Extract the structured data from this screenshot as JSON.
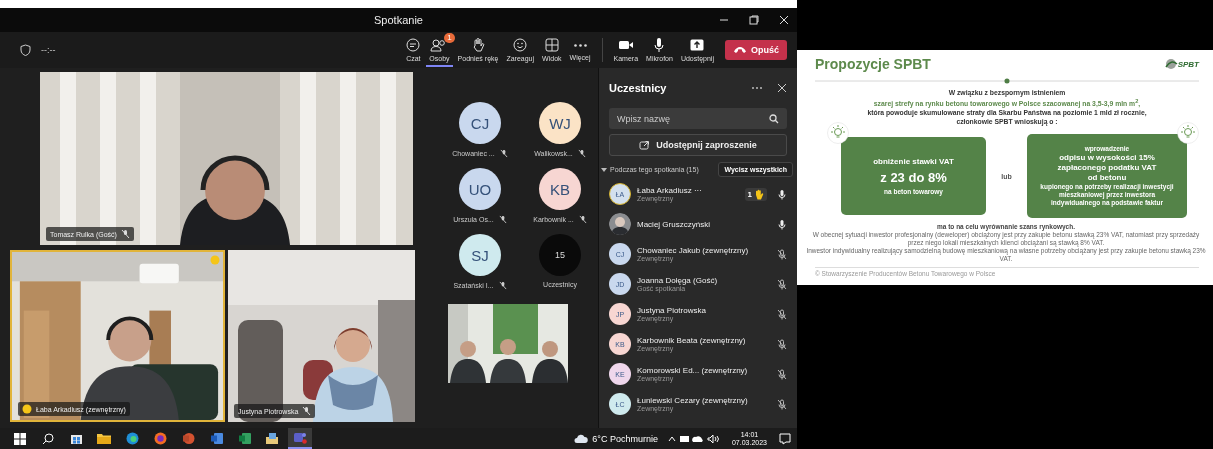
{
  "window": {
    "title": "Spotkanie"
  },
  "toolbar": {
    "timer": "--:--",
    "items": [
      {
        "kind": "chat",
        "label": "Czat",
        "selected": false
      },
      {
        "kind": "people",
        "label": "Osoby",
        "badge": "1",
        "selected": true
      },
      {
        "kind": "hand",
        "label": "Podnieś rękę",
        "selected": false
      },
      {
        "kind": "react",
        "label": "Zareaguj",
        "selected": false
      },
      {
        "kind": "view",
        "label": "Widok",
        "selected": false
      },
      {
        "kind": "more",
        "label": "Więcej",
        "selected": false
      }
    ],
    "devices": [
      {
        "kind": "camera",
        "label": "Kamera"
      },
      {
        "kind": "mic",
        "label": "Mikrofon"
      },
      {
        "kind": "share",
        "label": "Udostępnij"
      }
    ],
    "leave": "Opuść"
  },
  "videos": [
    {
      "kind": "picture",
      "name": "Tomasz Rulka (Gość)",
      "muted": true
    },
    {
      "kind": "picture",
      "name": "Łaba Arkadiusz (zewnętrzny)",
      "hand_raised": true,
      "highlighted": true
    },
    {
      "kind": "picture",
      "name": "Justyna Piotrowska",
      "muted": true
    },
    {
      "kind": "picture"
    }
  ],
  "avatar_grid": [
    {
      "kind": "person",
      "initials": "CJ",
      "name": "Chowaniec ...",
      "color": "#c9d8ee",
      "muted": true
    },
    {
      "kind": "person",
      "initials": "WJ",
      "name": "Walikowsk...",
      "color": "#fbe3c6",
      "muted": true
    },
    {
      "kind": "person",
      "initials": "UO",
      "name": "Urszula Os...",
      "color": "#c9d8ee",
      "muted": true
    },
    {
      "kind": "person",
      "initials": "KB",
      "name": "Karbownik ...",
      "color": "#f7d6d2",
      "muted": true
    },
    {
      "kind": "person",
      "initials": "SJ",
      "name": "Szatański I...",
      "color": "#cfeaee",
      "muted": true
    },
    {
      "kind": "overflow",
      "initials": "15",
      "name": "Uczestnicy"
    }
  ],
  "panel": {
    "title": "Uczestnicy",
    "search_placeholder": "Wpisz nazwę",
    "share_button": "Udostępnij zaproszenie",
    "section": {
      "label": "Podczas tego spotkania (15)",
      "expanded": true,
      "mute_all": "Wycisz wszystkich"
    },
    "participants": [
      {
        "kind": "initials",
        "initials": "ŁA",
        "name": "Łaba Arkadiusz ···",
        "role": "Zewnętrzny",
        "color": "#d3e0ee",
        "highlighted": true,
        "hand_count": "1",
        "muted": false
      },
      {
        "name": "Maciej Gruszczyński",
        "highlighted": false,
        "muted": false
      },
      {
        "kind": "initials",
        "initials": "CJ",
        "name": "Chowaniec Jakub (zewnętrzny)",
        "role": "Zewnętrzny",
        "color": "#c9d8ee",
        "highlighted": false,
        "muted": true
      },
      {
        "kind": "initials",
        "initials": "JD",
        "name": "Joanna Dołęga (Gość)",
        "role": "Gość spotkania",
        "color": "#c9d8ee",
        "highlighted": false,
        "muted": true
      },
      {
        "kind": "initials",
        "initials": "JP",
        "name": "Justyna Piotrowska",
        "role": "Zewnętrzny",
        "color": "#f7d6d2",
        "highlighted": false,
        "muted": true
      },
      {
        "kind": "initials",
        "initials": "KB",
        "name": "Karbownik Beata (zewnętrzny)",
        "role": "Zewnętrzny",
        "color": "#f7d6d2",
        "highlighted": false,
        "muted": true
      },
      {
        "kind": "initials",
        "initials": "KE",
        "name": "Komorowski Ed...  (zewnętrzny)",
        "role": "Zewnętrzny",
        "color": "#efd7ec",
        "highlighted": false,
        "muted": true
      },
      {
        "kind": "initials",
        "initials": "ŁC",
        "name": "Łuniewski Cezary (zewnętrzny)",
        "role": "Zewnętrzny",
        "color": "#cfeaee",
        "highlighted": false,
        "muted": true
      }
    ]
  },
  "slide": {
    "title": "Propozycje SPBT",
    "logo": "SPBT",
    "intro": [
      {
        "kind": "dark",
        "text": "W związku z bezspornym istnieniem"
      },
      {
        "kind": "green",
        "text": "szarej strefy na rynku betonu towarowego w Polsce szacowanej na 3,5-3,9 mln m$^{2}$,"
      },
      {
        "kind": "dark",
        "text": "która powoduje skumulowane straty dla Skarbu Państwa na poziomie 1 mld zł rocznie,"
      },
      {
        "kind": "dark",
        "text": "członkowie SPBT wnioskują o :"
      }
    ],
    "left_box": [
      {
        "kind": "medium",
        "text": "obniżenie stawki VAT"
      },
      {
        "kind": "large",
        "text": "z 23 do 8%"
      },
      {
        "kind": "small",
        "text": "na beton towarowy"
      }
    ],
    "or": "lub",
    "right_box": [
      {
        "kind": "tiny",
        "text": "wprowadzenie"
      },
      {
        "kind": "medium",
        "text": "odpisu w wysokości 15%"
      },
      {
        "kind": "medium",
        "text": "zapłaconego podatku VAT"
      },
      {
        "kind": "medium",
        "text": "od betonu"
      },
      {
        "kind": "tiny",
        "text": "kupionego na potrzeby realizacji inwestycji"
      },
      {
        "kind": "tiny",
        "text": "mieszkaniowej przez inwestora"
      },
      {
        "kind": "tiny",
        "text": "indywidualnego na podstawie faktur"
      }
    ],
    "notes": [
      {
        "kind": "bold",
        "text": "ma to na celu wyrównanie szans rynkowych."
      },
      {
        "kind": "plain",
        "text": "W obecnej sytuacji inwestor profesjonalny (deweloper) obciążony jest przy zakupie betonu stawką 23% VAT, natomiast przy sprzedaży przez niego lokali mieszkalnych klienci obciążani są stawką 8% VAT."
      },
      {
        "kind": "plain",
        "text": "Inwestor indywidualny realizujący samodzielną budowę mieszkaniową na własne potrzeby obciążany jest przy zakupie betonu stawką 23% VAT."
      }
    ],
    "footer": "© Stowarzyszenie Producentów Betonu Towarowego w Polsce"
  },
  "taskbar": {
    "apps": [
      {
        "kind": "start",
        "selected": false
      },
      {
        "kind": "search",
        "selected": false
      },
      {
        "kind": "store",
        "selected": false
      },
      {
        "kind": "folder",
        "selected": false
      },
      {
        "kind": "edge",
        "selected": false
      },
      {
        "kind": "firefox",
        "selected": false
      },
      {
        "kind": "powerpoint",
        "selected": false
      },
      {
        "kind": "word",
        "selected": false
      },
      {
        "kind": "excel",
        "selected": false
      },
      {
        "kind": "mail",
        "selected": false
      },
      {
        "kind": "teams",
        "selected": true
      }
    ],
    "weather": "6°C Pochmurnie",
    "time": "14:01",
    "date": "07.03.2023"
  }
}
